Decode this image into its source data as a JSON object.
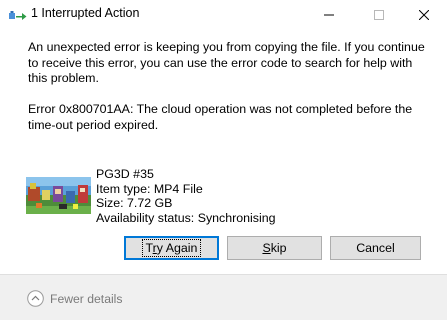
{
  "window": {
    "title": "1 Interrupted Action"
  },
  "message": {
    "main": "An unexpected error is keeping you from copying the file. If you continue to receive this error, you can use the error code to search for help with this problem.",
    "error": "Error 0x800701AA: The cloud operation was not completed before the time-out period expired."
  },
  "file": {
    "name": "PG3D #35",
    "type": "Item type: MP4 File",
    "size": "Size: 7.72 GB",
    "availability": "Availability status: Synchronising"
  },
  "buttons": {
    "try_again_pre": "T",
    "try_again_accel": "r",
    "try_again_post": "y Again",
    "skip_accel": "S",
    "skip_post": "kip",
    "cancel": "Cancel"
  },
  "footer": {
    "fewer_details": "Fewer details"
  },
  "colors": {
    "accent": "#0078d7",
    "button_face": "#e1e1e1",
    "footer_bg": "#f0f0f0",
    "muted_text": "#7a7a7a"
  },
  "icons": {
    "app": "copy-move-icon",
    "minimize": "minimize-icon",
    "maximize": "maximize-icon",
    "close": "close-icon",
    "details": "chevron-up-circle-icon"
  }
}
